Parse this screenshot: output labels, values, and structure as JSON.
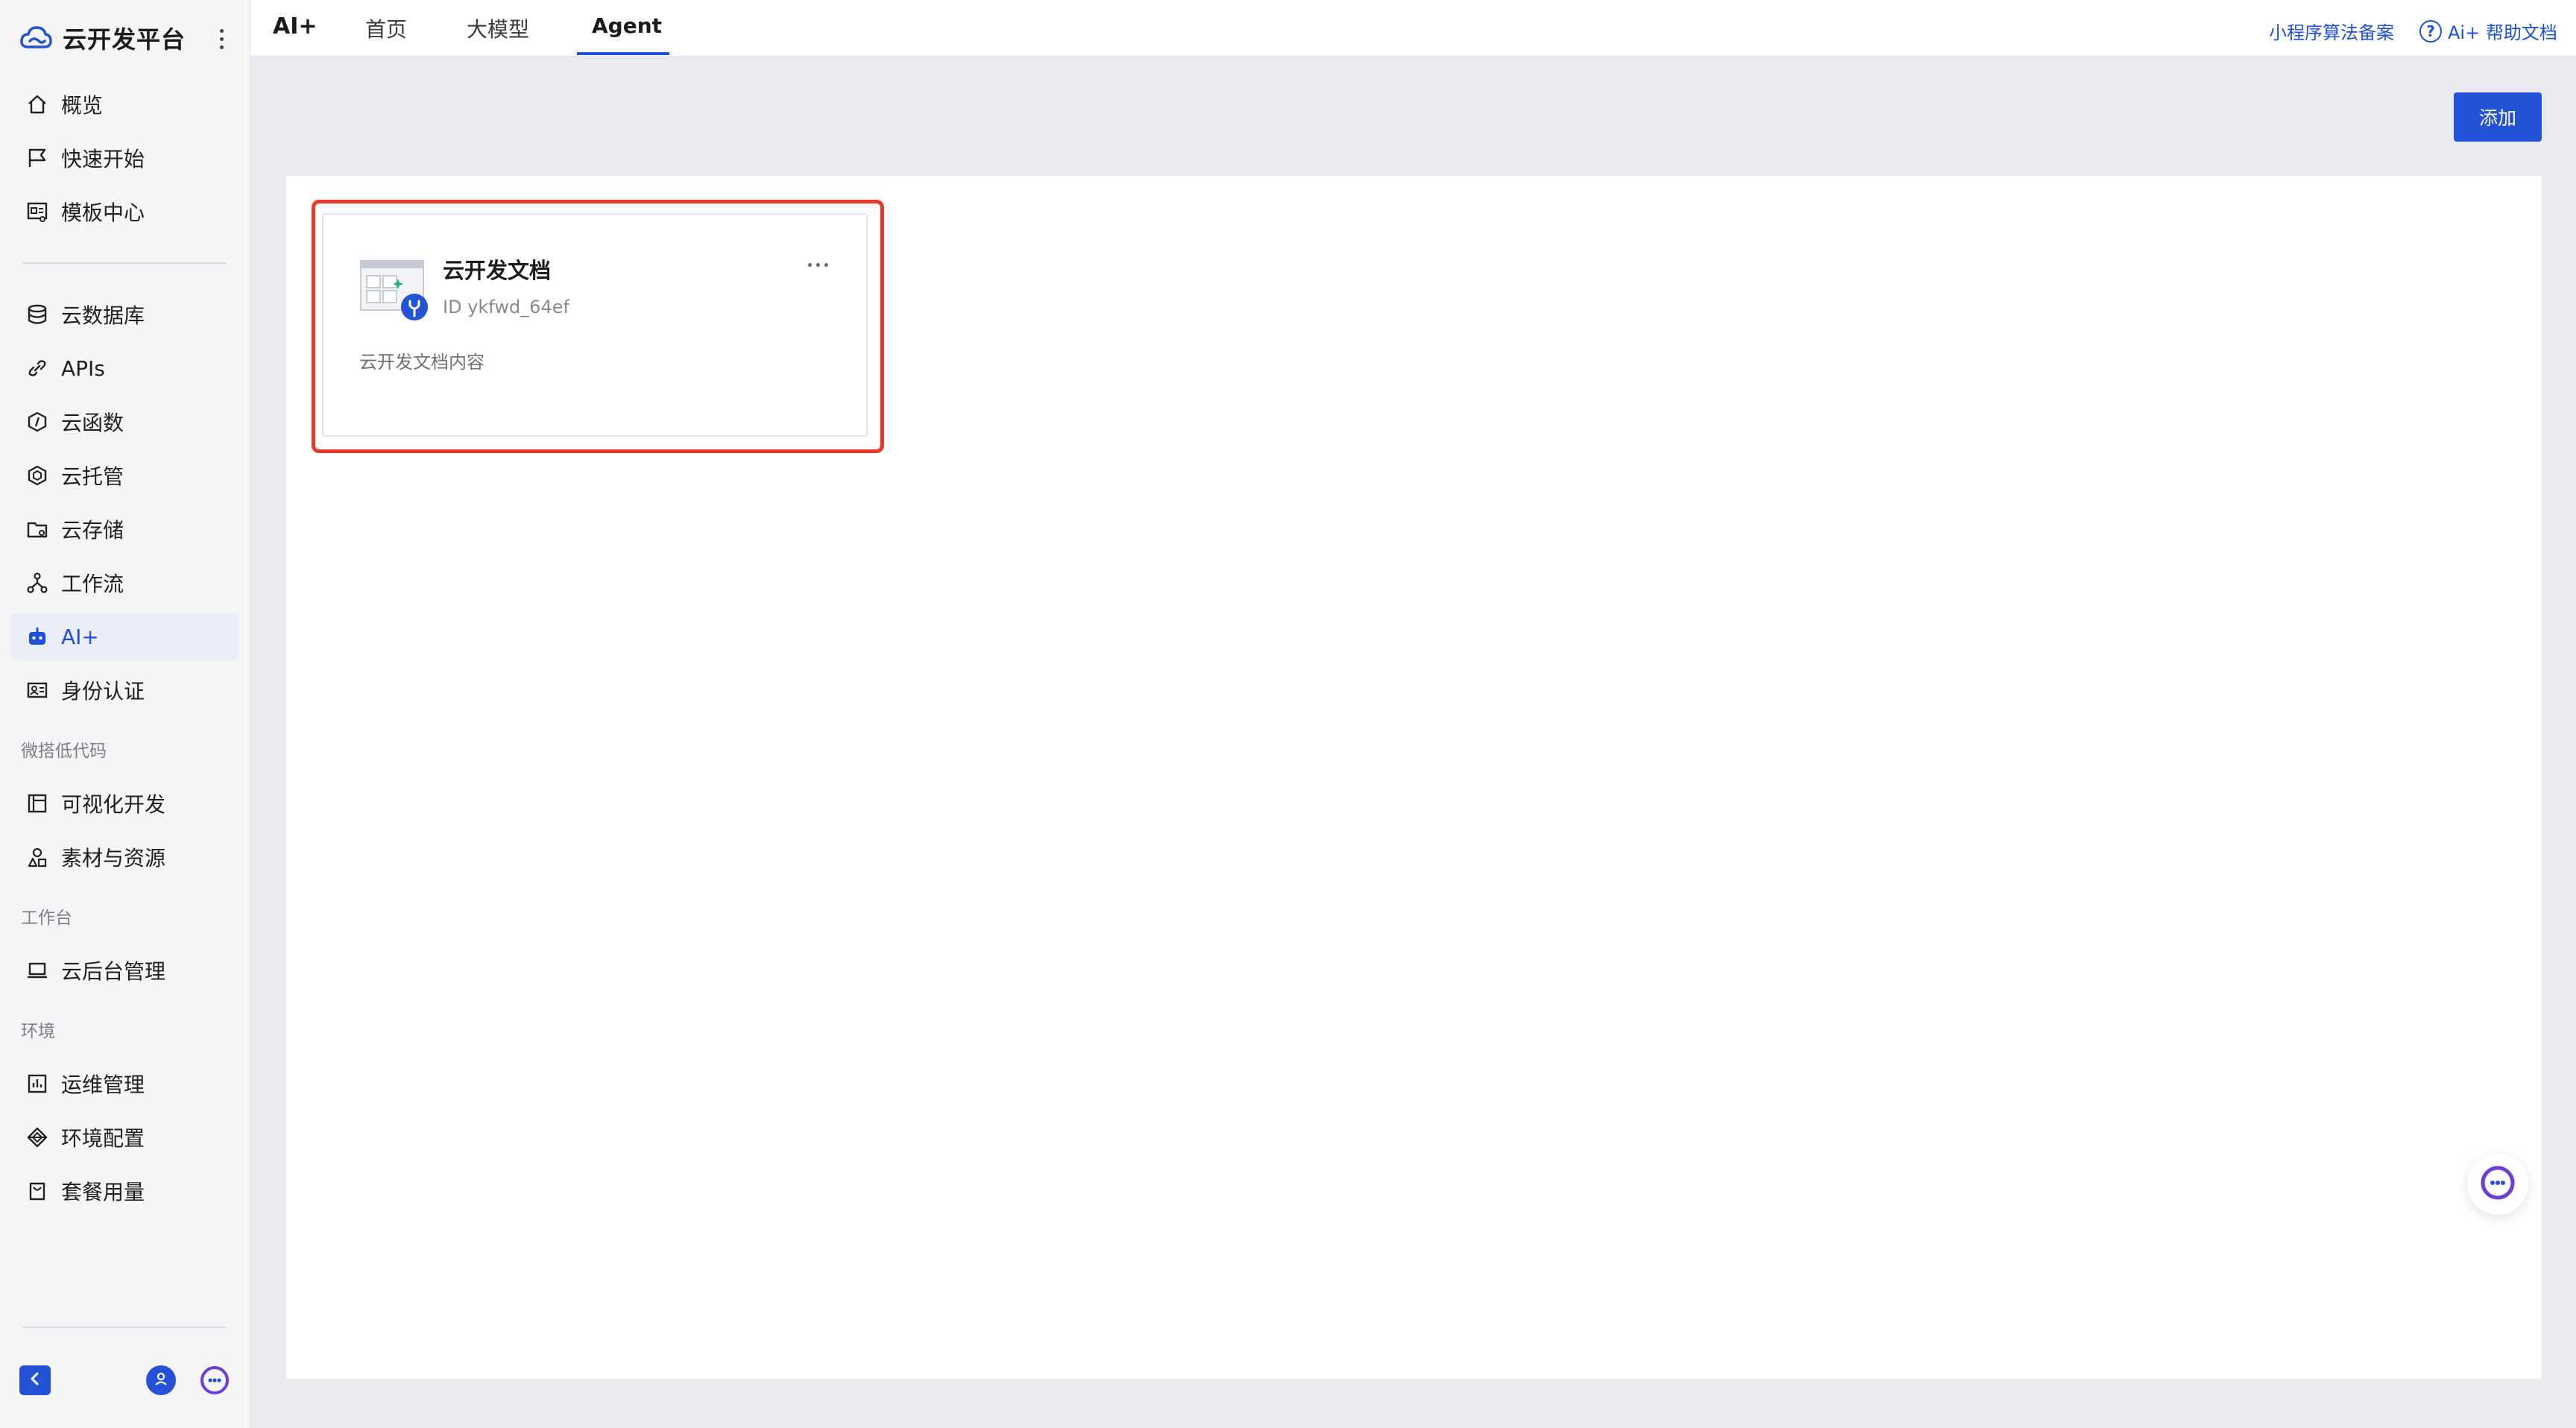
{
  "app": {
    "title": "云开发平台"
  },
  "sidebar": {
    "items_top": [
      {
        "label": "概览",
        "icon": "home-icon"
      },
      {
        "label": "快速开始",
        "icon": "flag-icon"
      },
      {
        "label": "模板中心",
        "icon": "template-icon"
      }
    ],
    "items_main": [
      {
        "label": "云数据库",
        "icon": "database-icon"
      },
      {
        "label": "APIs",
        "icon": "link-icon"
      },
      {
        "label": "云函数",
        "icon": "function-icon"
      },
      {
        "label": "云托管",
        "icon": "hexagon-icon"
      },
      {
        "label": "云存储",
        "icon": "folder-icon"
      },
      {
        "label": "工作流",
        "icon": "workflow-icon"
      },
      {
        "label": "AI+",
        "icon": "robot-icon",
        "active": true
      },
      {
        "label": "身份认证",
        "icon": "id-card-icon"
      }
    ],
    "section_lowcode": "微搭低代码",
    "items_lowcode": [
      {
        "label": "可视化开发",
        "icon": "layout-icon"
      },
      {
        "label": "素材与资源",
        "icon": "shapes-icon"
      }
    ],
    "section_workbench": "工作台",
    "items_workbench": [
      {
        "label": "云后台管理",
        "icon": "laptop-icon"
      }
    ],
    "section_env": "环境",
    "items_env": [
      {
        "label": "运维管理",
        "icon": "chart-icon"
      },
      {
        "label": "环境配置",
        "icon": "config-icon"
      },
      {
        "label": "套餐用量",
        "icon": "bag-icon"
      }
    ]
  },
  "topbar": {
    "section_title": "AI+",
    "tabs": [
      {
        "label": "首页"
      },
      {
        "label": "大模型"
      },
      {
        "label": "Agent",
        "active": true
      }
    ],
    "link_filing": "小程序算法备案",
    "link_help": "Ai+ 帮助文档"
  },
  "main": {
    "add_label": "添加",
    "cards": [
      {
        "name": "云开发文档",
        "id_text": "ID ykfwd_64ef",
        "description": "云开发文档内容"
      }
    ]
  },
  "colors": {
    "accent": "#1f4fd8",
    "highlight": "#e53a2a"
  }
}
